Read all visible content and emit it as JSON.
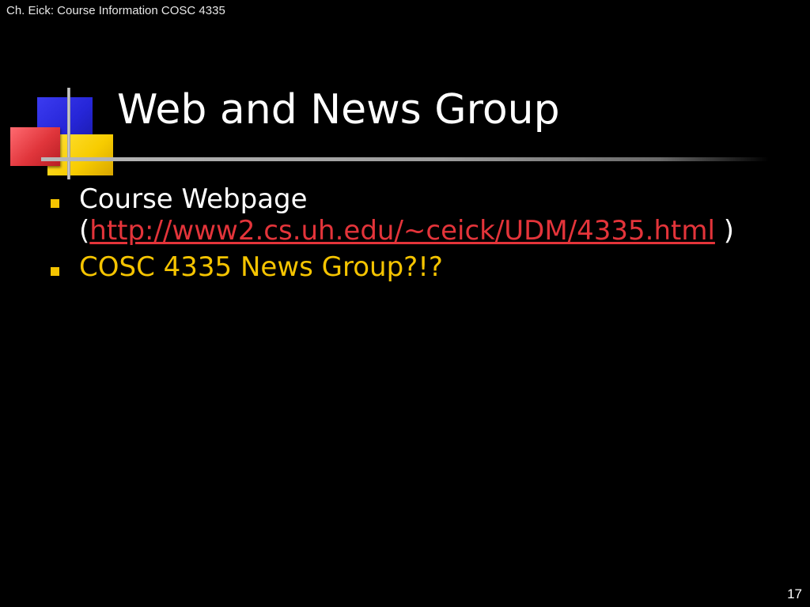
{
  "header": {
    "note": "Ch. Eick: Course Information COSC 4335"
  },
  "slide": {
    "title": "Web and News Group",
    "bullets": [
      {
        "text": "Course Webpage",
        "open_paren": "(",
        "link": "http://www2.cs.uh.edu/~ceick/UDM/4335.html",
        "close_paren": " )"
      },
      {
        "text": "COSC 4335 News Group?!?"
      }
    ]
  },
  "footer": {
    "page_number": "17"
  },
  "colors": {
    "background": "#000000",
    "title": "#ffffff",
    "link": "#e3343a",
    "accent_yellow": "#f5c400",
    "deco_blue": "#2626d8",
    "deco_red": "#e0353b"
  }
}
